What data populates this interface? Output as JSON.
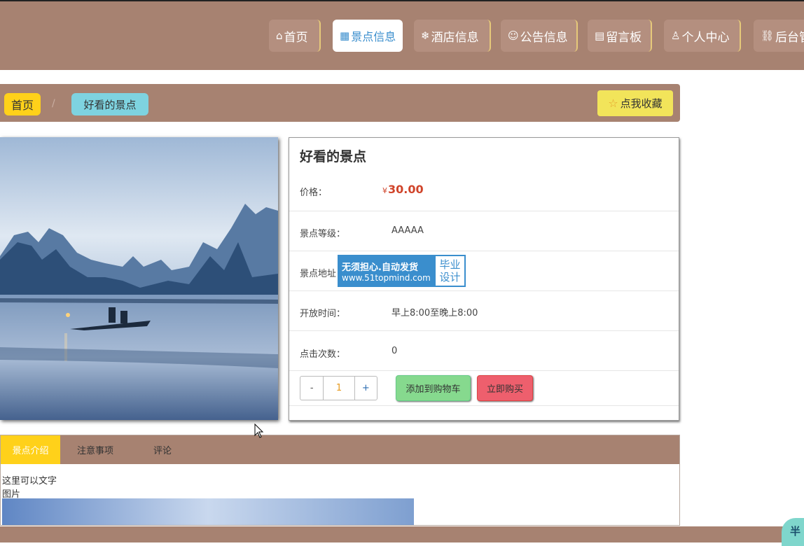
{
  "nav": {
    "items": [
      {
        "icon": "⌂",
        "label": "首页"
      },
      {
        "icon": "▦",
        "label": "景点信息"
      },
      {
        "icon": "❄",
        "label": "酒店信息"
      },
      {
        "icon": "☺",
        "label": "公告信息"
      },
      {
        "icon": "▤",
        "label": "留言板"
      },
      {
        "icon": "♙",
        "label": "个人中心"
      },
      {
        "icon": "⛓",
        "label": "后台管"
      }
    ],
    "active_index": 1
  },
  "breadcrumb": {
    "home": "首页",
    "separator": "/",
    "current": "好看的景点"
  },
  "favorite_button": {
    "icon": "☆",
    "label": "点我收藏"
  },
  "detail": {
    "title": "好看的景点",
    "price_label": "价格：",
    "currency": "¥",
    "price": "30.00",
    "rows": [
      {
        "label": "景点等级：",
        "value": "AAAAA"
      },
      {
        "label": "景点地址：",
        "value": ""
      },
      {
        "label": "开放时间：",
        "value": "早上8:00至晚上8:00"
      },
      {
        "label": "点击次数：",
        "value": "0"
      }
    ],
    "quantity": {
      "minus": "-",
      "value": "1",
      "plus": "+"
    },
    "add_to_cart": "添加到购物车",
    "buy_now": "立即购买"
  },
  "watermark": {
    "line1": "无须担心.自动发货",
    "line2": "www.51topmind.com",
    "right1": "毕业",
    "right2": "设计"
  },
  "tabs": {
    "items": [
      "景点介绍",
      "注意事项",
      "评论"
    ],
    "active_index": 0
  },
  "description": {
    "line1": "这里可以文字",
    "line2": "图片"
  },
  "float_widget": {
    "label": "半"
  },
  "colors": {
    "header": "#a78271",
    "active_tab": "#ffd11a",
    "accent_blue": "#3a8ecd",
    "price_red": "#d0442a",
    "cart_green": "#86d98e",
    "buy_red": "#ee5f6d"
  }
}
